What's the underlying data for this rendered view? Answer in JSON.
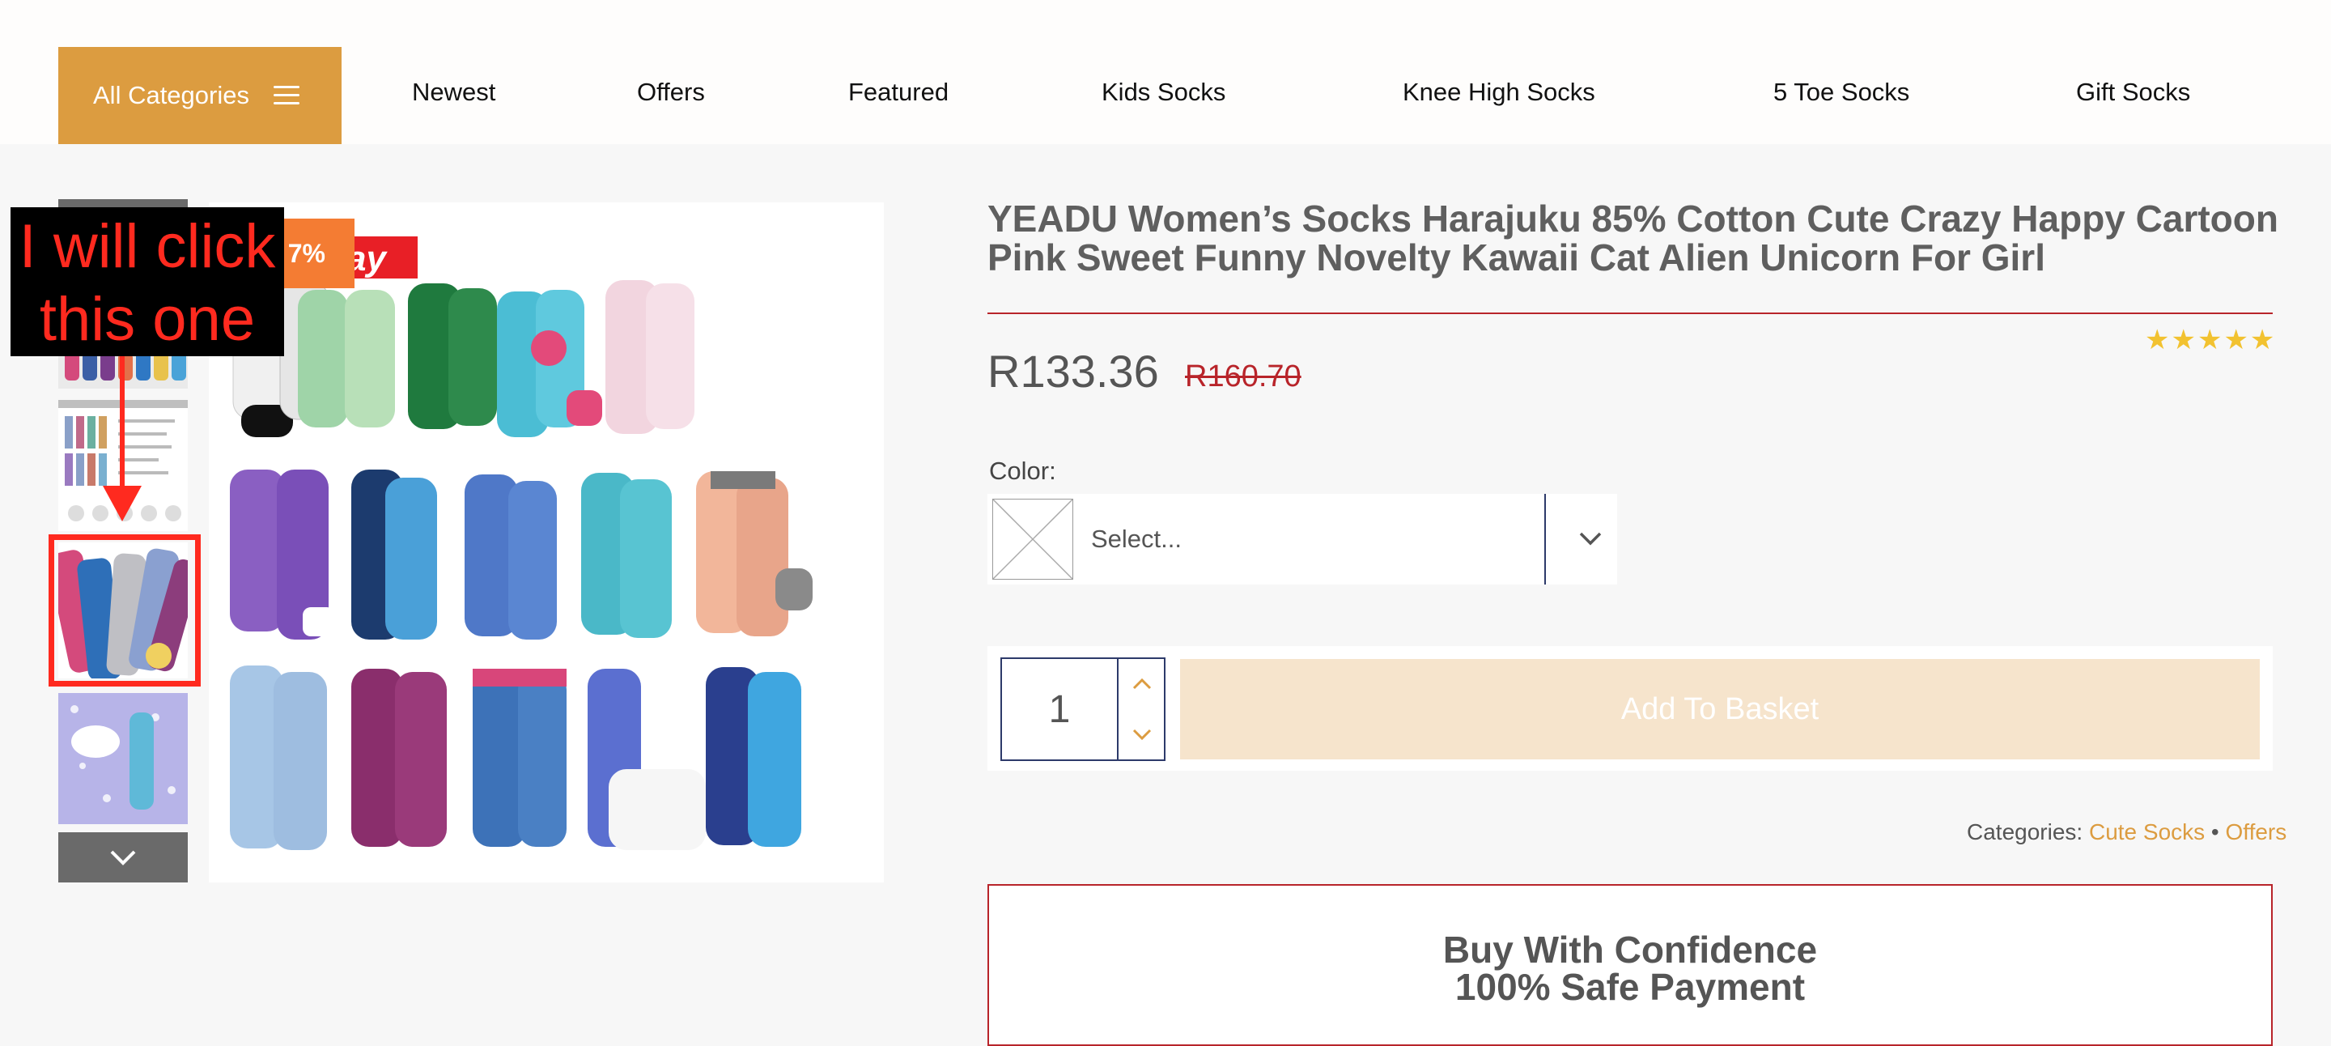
{
  "header": {
    "all_categories_label": "All Categories",
    "nav": [
      "Newest",
      "Offers",
      "Featured",
      "Kids Socks",
      "Knee High Socks",
      "5 Toe Socks",
      "Gift Socks"
    ]
  },
  "gallery": {
    "discount_badge": "7%",
    "brand_mark": "ay"
  },
  "annotation": {
    "line1": "I will click",
    "line2": "this one"
  },
  "product": {
    "title_line1": "YEADU Women’s Socks Harajuku 85% Cotton Cute Crazy Happy Cartoon",
    "title_line2": "Pink Sweet Funny Novelty Kawaii Cat Alien Unicorn For Girl",
    "rating_stars": "★★★★★",
    "rating": 5,
    "price": "R133.36",
    "old_price": "R160.70",
    "color_label": "Color:",
    "color_placeholder": "Select...",
    "quantity": "1",
    "add_to_basket": "Add To Basket",
    "categories_label": "Categories:",
    "categories": [
      "Cute Socks",
      "Offers"
    ],
    "categories_separator": "•",
    "confidence_line1": "Buy With Confidence",
    "confidence_line2": "100% Safe Payment"
  },
  "colors": {
    "accent": "#dc9c40",
    "badge": "#f47c33",
    "sale_red": "#b8242a",
    "navy": "#2d3a6a",
    "add_button_bg": "#f6e4cc",
    "annotation_red": "#ff2a1f"
  }
}
